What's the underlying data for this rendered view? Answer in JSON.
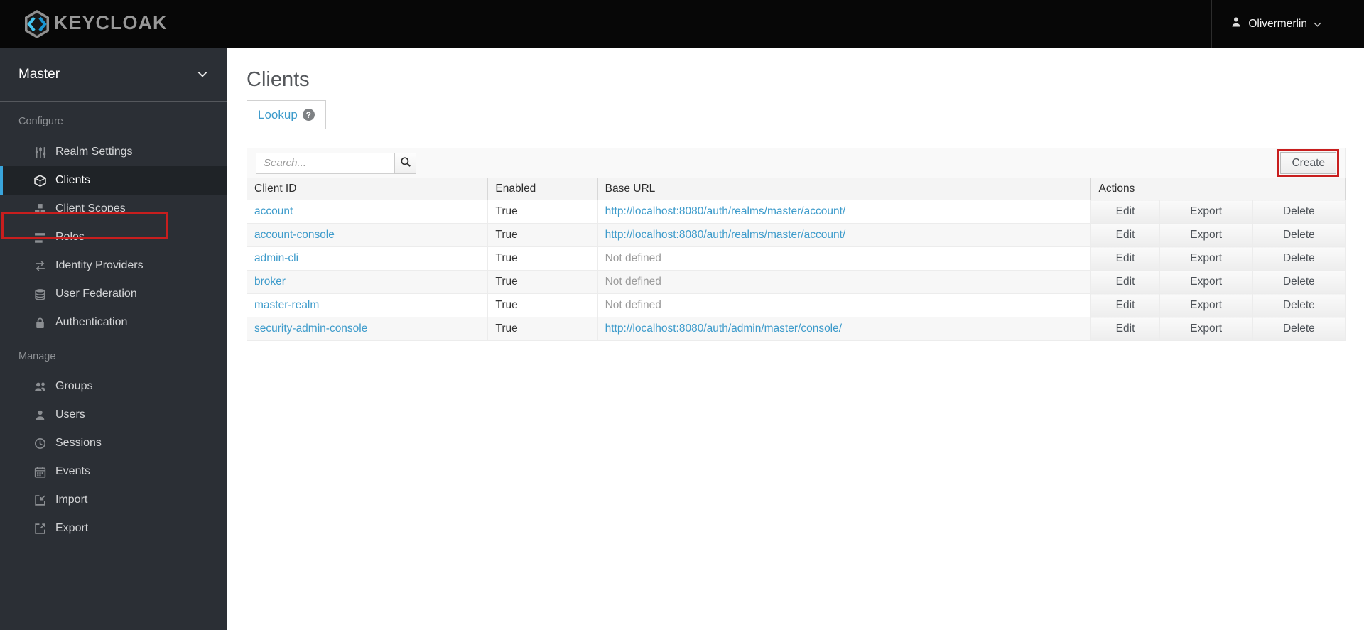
{
  "topbar": {
    "brand": "KEYCLOAK",
    "user": {
      "name": "Olivermerlin"
    }
  },
  "sidebar": {
    "realm": "Master",
    "sections": [
      {
        "label": "Configure",
        "items": [
          {
            "label": "Realm Settings",
            "icon": "sliders-icon",
            "selected": false
          },
          {
            "label": "Clients",
            "icon": "cube-icon",
            "selected": true,
            "annotated": true
          },
          {
            "label": "Client Scopes",
            "icon": "cubes-icon",
            "selected": false
          },
          {
            "label": "Roles",
            "icon": "list-icon",
            "selected": false
          },
          {
            "label": "Identity Providers",
            "icon": "exchange-icon",
            "selected": false
          },
          {
            "label": "User Federation",
            "icon": "database-icon",
            "selected": false
          },
          {
            "label": "Authentication",
            "icon": "lock-icon",
            "selected": false
          }
        ]
      },
      {
        "label": "Manage",
        "items": [
          {
            "label": "Groups",
            "icon": "users-icon",
            "selected": false
          },
          {
            "label": "Users",
            "icon": "user-icon",
            "selected": false
          },
          {
            "label": "Sessions",
            "icon": "clock-icon",
            "selected": false
          },
          {
            "label": "Events",
            "icon": "calendar-icon",
            "selected": false
          },
          {
            "label": "Import",
            "icon": "import-icon",
            "selected": false
          },
          {
            "label": "Export",
            "icon": "export-icon",
            "selected": false
          }
        ]
      }
    ]
  },
  "main": {
    "title": "Clients",
    "tab": {
      "label": "Lookup",
      "help_icon": "?"
    },
    "toolbar": {
      "search_placeholder": "Search...",
      "create_label": "Create"
    },
    "table": {
      "headers": [
        "Client ID",
        "Enabled",
        "Base URL",
        "Actions"
      ],
      "actions": [
        "Edit",
        "Export",
        "Delete"
      ],
      "rows": [
        {
          "client_id": "account",
          "enabled": "True",
          "base_url": "http://localhost:8080/auth/realms/master/account/",
          "base_url_defined": true
        },
        {
          "client_id": "account-console",
          "enabled": "True",
          "base_url": "http://localhost:8080/auth/realms/master/account/",
          "base_url_defined": true
        },
        {
          "client_id": "admin-cli",
          "enabled": "True",
          "base_url": "Not defined",
          "base_url_defined": false
        },
        {
          "client_id": "broker",
          "enabled": "True",
          "base_url": "Not defined",
          "base_url_defined": false
        },
        {
          "client_id": "master-realm",
          "enabled": "True",
          "base_url": "Not defined",
          "base_url_defined": false
        },
        {
          "client_id": "security-admin-console",
          "enabled": "True",
          "base_url": "http://localhost:8080/auth/admin/master/console/",
          "base_url_defined": true
        }
      ]
    }
  },
  "colors": {
    "accent_blue": "#39a5dc",
    "link_blue": "#3d9bcb",
    "annotation_red": "#c81e1e",
    "topbar_black": "#070707",
    "sidebar_dark": "#2b2f35"
  }
}
